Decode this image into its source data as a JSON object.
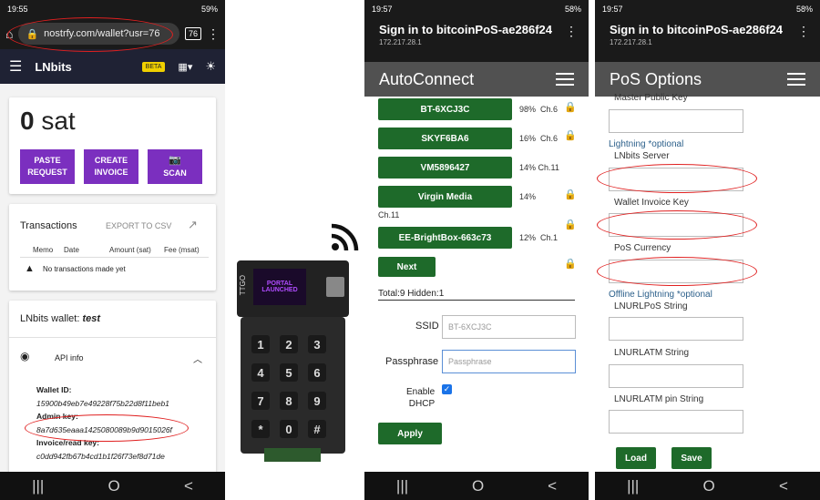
{
  "lnbits": {
    "status_time": "19:55",
    "status_battery": "59%",
    "url": "nostrfy.com/wallet?usr=76",
    "tab_count": "76",
    "app_name": "LNbits",
    "beta": "BETA",
    "balance_value": "0",
    "balance_unit": "sat",
    "paste_line1": "PASTE",
    "paste_line2": "REQUEST",
    "create_line1": "CREATE",
    "create_line2": "INVOICE",
    "scan": "SCAN",
    "transactions_title": "Transactions",
    "export_csv": "EXPORT TO CSV",
    "columns": [
      "Memo",
      "Date",
      "Amount (sat)",
      "Fee (msat)"
    ],
    "no_tx": "No transactions made yet",
    "wallet_label": "LNbits wallet: ",
    "wallet_name": "test",
    "api_info": "API info",
    "wallet_id_label": "Wallet ID:",
    "wallet_id": "15900b49eb7e49228f75b22d8f11beb1",
    "admin_key_label": "Admin key:",
    "admin_key": "8a7d635eaaa1425080089b9d9015026f",
    "invoice_key_label": "Invoice/read key:",
    "invoice_key": "c0dd942fb67b4cd1b1f26f73ef8d71de"
  },
  "device": {
    "screen_line1": "PORTAL",
    "screen_line2": "LAUNCHED",
    "board_label": "TTGO",
    "keys": [
      "1",
      "2",
      "3",
      "4",
      "5",
      "6",
      "7",
      "8",
      "9",
      "*",
      "0",
      "#"
    ]
  },
  "autoconnect": {
    "status_time": "19:57",
    "status_battery": "58%",
    "title": "Sign in to bitcoinPoS-ae286f24",
    "ip": "172.217.28.1",
    "header": "AutoConnect",
    "networks": [
      {
        "ssid": "BT-6XCJ3C",
        "signal": "98%",
        "channel": "Ch.6"
      },
      {
        "ssid": "SKYF6BA6",
        "signal": "16%",
        "channel": "Ch.6"
      },
      {
        "ssid": "VM5896427",
        "signal": "14%",
        "channel": "Ch.11"
      },
      {
        "ssid": "Virgin Media",
        "signal": "14%",
        "channel": "Ch.11"
      },
      {
        "ssid": "EE-BrightBox-663c73",
        "signal": "12%",
        "channel": "Ch.1"
      }
    ],
    "next": "Next",
    "total": "Total:9 Hidden:1",
    "ssid_label": "SSID",
    "ssid_value": "BT-6XCJ3C",
    "pass_label": "Passphrase",
    "pass_placeholder": "Passphrase",
    "dhcp_line1": "Enable",
    "dhcp_line2": "DHCP",
    "apply": "Apply"
  },
  "pos": {
    "status_time": "19:57",
    "status_battery": "58%",
    "title": "Sign in to bitcoinPoS-ae286f24",
    "ip": "172.217.28.1",
    "header": "PoS Options",
    "master_key": "Master Public Key",
    "lightning_section": "Lightning *optional",
    "lnbits_server": "LNbits Server",
    "wallet_invoice_key": "Wallet Invoice Key",
    "pos_currency": "PoS Currency",
    "offline_section": "Offline Lightning *optional",
    "lnurlpos": "LNURLPoS String",
    "lnurlatm": "LNURLATM String",
    "lnurlatm_pin": "LNURLATM pin String",
    "load": "Load",
    "save": "Save"
  },
  "nav": {
    "recent": "|||",
    "home": "O",
    "back": "<"
  }
}
